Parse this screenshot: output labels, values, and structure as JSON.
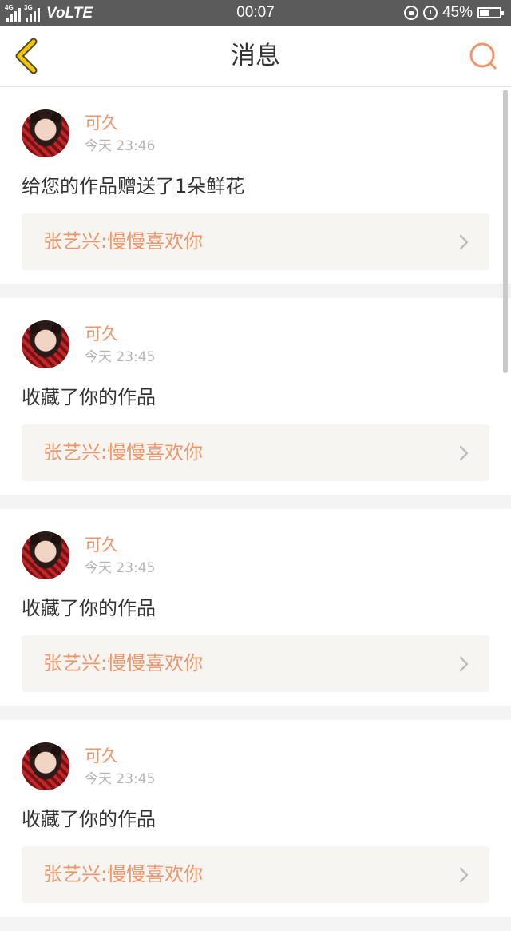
{
  "status_bar": {
    "signal1_label": "4G",
    "signal2_label": "3G",
    "network": "VoLTE",
    "time": "00:07",
    "battery_text": "45%",
    "battery_level": 0.45,
    "icons": [
      "signal-icon",
      "signal-icon",
      "lock-rotation-icon",
      "alarm-icon",
      "battery-icon"
    ]
  },
  "header": {
    "title": "消息",
    "back_icon": "chevron-left-icon",
    "search_icon": "search-icon",
    "accent_color": "#f0956a",
    "back_color": "#f5c400"
  },
  "messages": [
    {
      "user": "可久",
      "time": "今天 23:46",
      "action": "给您的作品赠送了1朵鲜花",
      "work": "张艺兴:慢慢喜欢你"
    },
    {
      "user": "可久",
      "time": "今天 23:45",
      "action": "收藏了你的作品",
      "work": "张艺兴:慢慢喜欢你"
    },
    {
      "user": "可久",
      "time": "今天 23:45",
      "action": "收藏了你的作品",
      "work": "张艺兴:慢慢喜欢你"
    },
    {
      "user": "可久",
      "time": "今天 23:45",
      "action": "收藏了你的作品",
      "work": "张艺兴:慢慢喜欢你"
    }
  ]
}
